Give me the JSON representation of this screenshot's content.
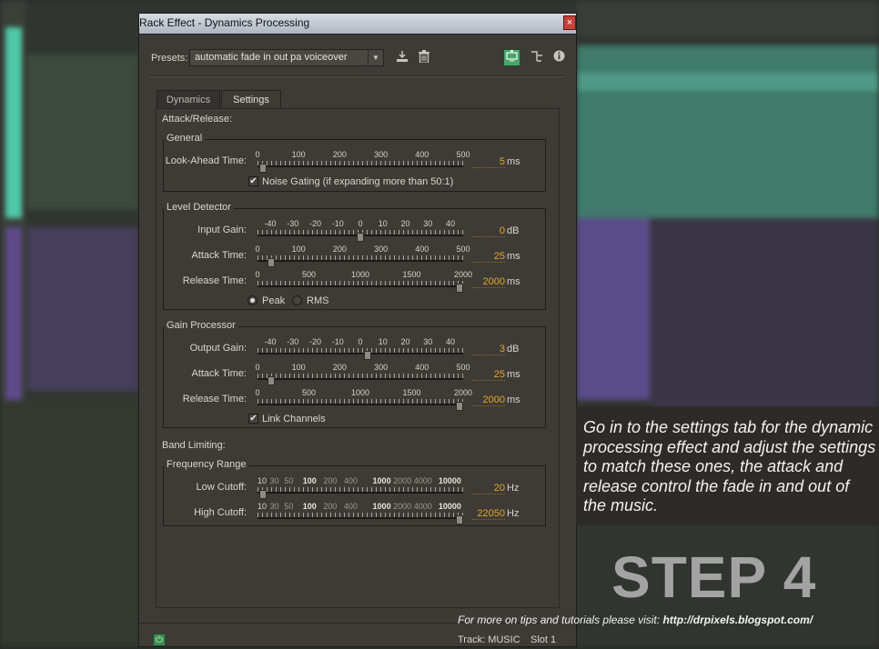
{
  "window": {
    "title": "Rack Effect - Dynamics Processing",
    "close_label": "×"
  },
  "presets": {
    "label": "Presets:",
    "value": "automatic fade in out pa voiceover"
  },
  "icons": {
    "save": "save-preset-icon",
    "delete": "trash-icon",
    "monitor": "monitor-icon",
    "routing": "routing-icon",
    "info": "info-icon"
  },
  "tabs": [
    {
      "label": "Dynamics",
      "active": false
    },
    {
      "label": "Settings",
      "active": true
    }
  ],
  "sections": {
    "attack_release": "Attack/Release:",
    "band_limiting": "Band Limiting:"
  },
  "general": {
    "title": "General",
    "lookahead": {
      "label": "Look-Ahead Time:",
      "ticks": [
        "0",
        "100",
        "200",
        "300",
        "400",
        "500"
      ],
      "value": "5",
      "unit": "ms",
      "fraction": 0.01
    },
    "noise_gating": {
      "label": "Noise Gating (if expanding more than 50:1)",
      "checked": true
    }
  },
  "level_detector": {
    "title": "Level Detector",
    "input_gain": {
      "label": "Input Gain:",
      "ticks": [
        "-40",
        "-30",
        "-20",
        "-10",
        "0",
        "10",
        "20",
        "30",
        "40"
      ],
      "value": "0",
      "unit": "dB",
      "fraction": 0.5
    },
    "attack": {
      "label": "Attack Time:",
      "ticks": [
        "0",
        "100",
        "200",
        "300",
        "400",
        "500"
      ],
      "value": "25",
      "unit": "ms",
      "fraction": 0.05
    },
    "release": {
      "label": "Release Time:",
      "ticks": [
        "0",
        "500",
        "1000",
        "1500",
        "2000"
      ],
      "value": "2000",
      "unit": "ms",
      "fraction": 1.0
    },
    "mode": {
      "peak": "Peak",
      "rms": "RMS",
      "selected": "Peak"
    }
  },
  "gain_processor": {
    "title": "Gain Processor",
    "output_gain": {
      "label": "Output Gain:",
      "ticks": [
        "-40",
        "-30",
        "-20",
        "-10",
        "0",
        "10",
        "20",
        "30",
        "40"
      ],
      "value": "3",
      "unit": "dB",
      "fraction": 0.537
    },
    "attack": {
      "label": "Attack Time:",
      "ticks": [
        "0",
        "100",
        "200",
        "300",
        "400",
        "500"
      ],
      "value": "25",
      "unit": "ms",
      "fraction": 0.05
    },
    "release": {
      "label": "Release Time:",
      "ticks": [
        "0",
        "500",
        "1000",
        "1500",
        "2000"
      ],
      "value": "2000",
      "unit": "ms",
      "fraction": 1.0
    },
    "link_channels": {
      "label": "Link Channels",
      "checked": true
    }
  },
  "frequency_range": {
    "title": "Frequency Range",
    "ticks": [
      "10",
      "30",
      "50",
      "100",
      "200",
      "400",
      "1000",
      "2000",
      "4000",
      "10000"
    ],
    "low": {
      "label": "Low Cutoff:",
      "value": "20",
      "unit": "Hz",
      "fraction": 0.01
    },
    "high": {
      "label": "High Cutoff:",
      "value": "22050",
      "unit": "Hz",
      "fraction": 1.0
    }
  },
  "status": {
    "track": "Track: MUSIC",
    "slot": "Slot 1"
  },
  "overlay": {
    "caption": "Go in to the settings tab for the dynamic processing effect and adjust the settings to match these ones, the attack and release control the fade in and out of the music.",
    "step": "STEP 4",
    "footer_text": "For more on tips and tutorials please visit: ",
    "footer_url": "http://drpixels.blogspot.com/"
  },
  "colors": {
    "accent_value": "#e4a727",
    "panel_bg": "#3e3b37",
    "power_green": "#3b8c52"
  }
}
